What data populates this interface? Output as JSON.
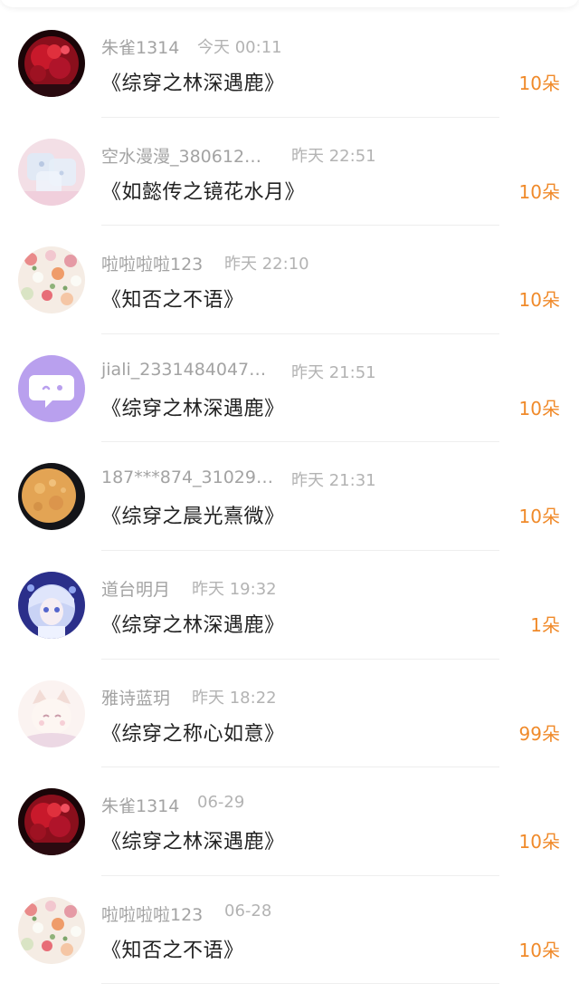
{
  "gift_list": {
    "items": [
      {
        "user": "朱雀1314",
        "time": "今天 00:11",
        "book": "《综穿之林深遇鹿》",
        "amount": "10朵",
        "avatar_icon": "red-flowers-avatar"
      },
      {
        "user": "空水漫漫_380612…",
        "time": "昨天 22:51",
        "book": "《如懿传之镜花水月》",
        "amount": "10朵",
        "avatar_icon": "ice-cube-avatar"
      },
      {
        "user": "啦啦啦啦123",
        "time": "昨天 22:10",
        "book": "《知否之不语》",
        "amount": "10朵",
        "avatar_icon": "floral-pattern-avatar"
      },
      {
        "user": "jiali_2331484047…",
        "time": "昨天 21:51",
        "book": "《综穿之林深遇鹿》",
        "amount": "10朵",
        "avatar_icon": "chat-bubble-avatar"
      },
      {
        "user": "187***874_31029…",
        "time": "昨天 21:31",
        "book": "《综穿之晨光熹微》",
        "amount": "10朵",
        "avatar_icon": "moon-avatar"
      },
      {
        "user": "道台明月",
        "time": "昨天 19:32",
        "book": "《综穿之林深遇鹿》",
        "amount": "1朵",
        "avatar_icon": "anime-girl-avatar"
      },
      {
        "user": "雅诗蓝玥",
        "time": "昨天 18:22",
        "book": "《综穿之称心如意》",
        "amount": "99朵",
        "avatar_icon": "cat-girl-avatar"
      },
      {
        "user": "朱雀1314",
        "time": "06-29",
        "book": "《综穿之林深遇鹿》",
        "amount": "10朵",
        "avatar_icon": "red-flowers-avatar"
      },
      {
        "user": "啦啦啦啦123",
        "time": "06-28",
        "book": "《知否之不语》",
        "amount": "10朵",
        "avatar_icon": "floral-pattern-avatar"
      }
    ]
  },
  "colors": {
    "amount": "#f08a2a",
    "username": "#a3a3a3",
    "title_text": "#222222",
    "divider": "#eeeeee"
  }
}
